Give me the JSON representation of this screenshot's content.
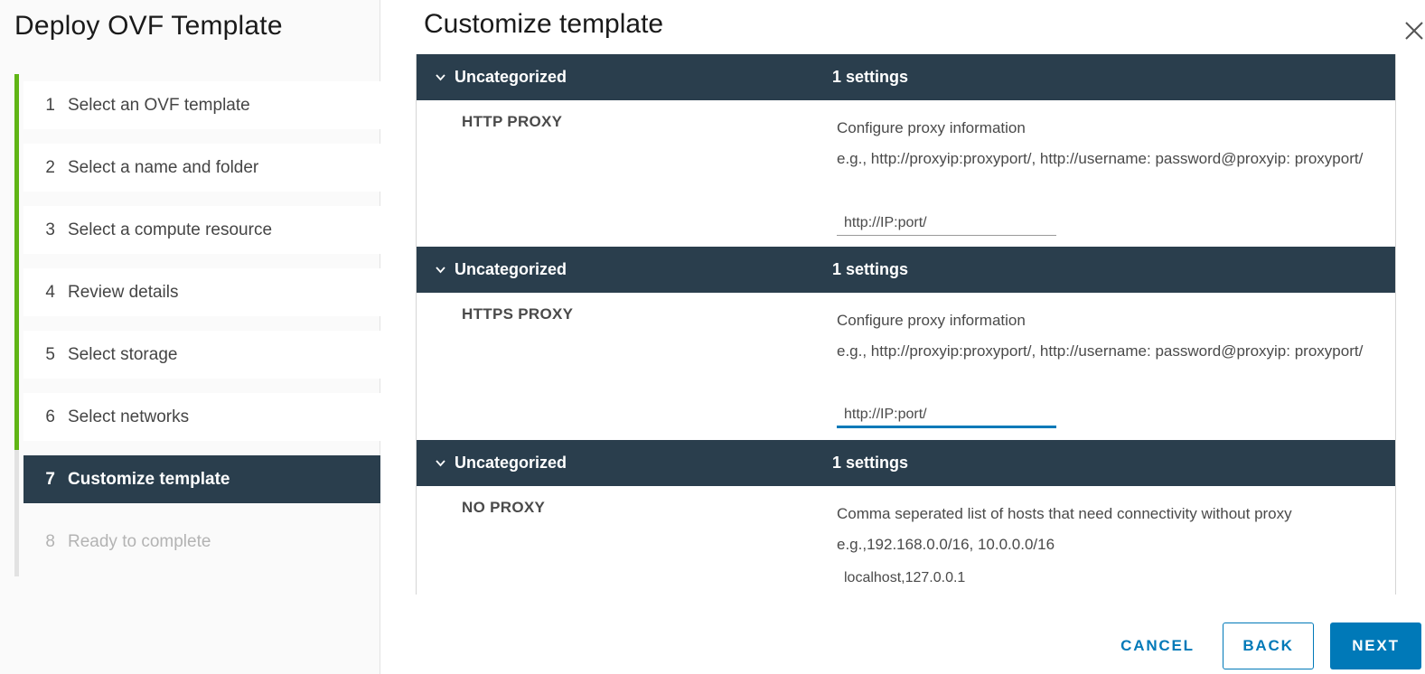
{
  "wizard": {
    "title": "Deploy OVF Template",
    "steps": [
      {
        "num": "1",
        "label": "Select an OVF template",
        "state": "done"
      },
      {
        "num": "2",
        "label": "Select a name and folder",
        "state": "done"
      },
      {
        "num": "3",
        "label": "Select a compute resource",
        "state": "done"
      },
      {
        "num": "4",
        "label": "Review details",
        "state": "done"
      },
      {
        "num": "5",
        "label": "Select storage",
        "state": "done"
      },
      {
        "num": "6",
        "label": "Select networks",
        "state": "done"
      },
      {
        "num": "7",
        "label": "Customize template",
        "state": "active"
      },
      {
        "num": "8",
        "label": "Ready to complete",
        "state": "disabled"
      }
    ]
  },
  "page": {
    "title": "Customize template",
    "close_icon": "close-icon"
  },
  "groups": [
    {
      "name": "Uncategorized",
      "count": "1 settings",
      "property": {
        "name": "HTTP PROXY",
        "desc_line1": "Configure proxy information",
        "desc_line2": "e.g., http://proxyip:proxyport/, http://username: password@proxyip: proxyport/",
        "value": "http://IP:port/"
      }
    },
    {
      "name": "Uncategorized",
      "count": "1 settings",
      "property": {
        "name": "HTTPS PROXY",
        "desc_line1": "Configure proxy information",
        "desc_line2": "e.g., http://proxyip:proxyport/, http://username: password@proxyip: proxyport/",
        "value": "http://IP:port/"
      }
    },
    {
      "name": "Uncategorized",
      "count": "1 settings",
      "property": {
        "name": "NO PROXY",
        "desc_line1": "Comma seperated list of hosts that need connectivity without proxy",
        "desc_line2": "e.g.,192.168.0.0/16, 10.0.0.0/16",
        "value": "localhost,127.0.0.1"
      }
    }
  ],
  "footer": {
    "cancel": "CANCEL",
    "back": "BACK",
    "next": "NEXT"
  },
  "colors": {
    "header_dark": "#2a3e4d",
    "progress_green": "#60b515",
    "primary_blue": "#0079b8"
  }
}
